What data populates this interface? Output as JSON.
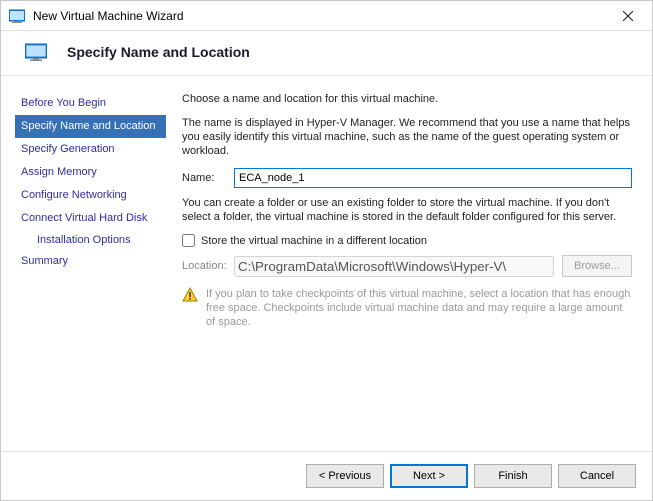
{
  "titlebar": {
    "title": "New Virtual Machine Wizard"
  },
  "header": {
    "heading": "Specify Name and Location"
  },
  "nav": {
    "items": [
      {
        "label": "Before You Begin"
      },
      {
        "label": "Specify Name and Location"
      },
      {
        "label": "Specify Generation"
      },
      {
        "label": "Assign Memory"
      },
      {
        "label": "Configure Networking"
      },
      {
        "label": "Connect Virtual Hard Disk"
      },
      {
        "label": "Summary"
      }
    ],
    "subitem": {
      "label": "Installation Options"
    }
  },
  "content": {
    "intro": "Choose a name and location for this virtual machine.",
    "desc": "The name is displayed in Hyper-V Manager. We recommend that you use a name that helps you easily identify this virtual machine, such as the name of the guest operating system or workload.",
    "name_label": "Name:",
    "name_value": "ECA_node_1",
    "folder_desc": "You can create a folder or use an existing folder to store the virtual machine. If you don't select a folder, the virtual machine is stored in the default folder configured for this server.",
    "store_chk": "Store the virtual machine in a different location",
    "location_label": "Location:",
    "location_value": "C:\\ProgramData\\Microsoft\\Windows\\Hyper-V\\",
    "browse_label": "Browse...",
    "warn_text": "If you plan to take checkpoints of this virtual machine, select a location that has enough free space. Checkpoints include virtual machine data and may require a large amount of space."
  },
  "footer": {
    "previous": "< Previous",
    "next": "Next >",
    "finish": "Finish",
    "cancel": "Cancel"
  }
}
